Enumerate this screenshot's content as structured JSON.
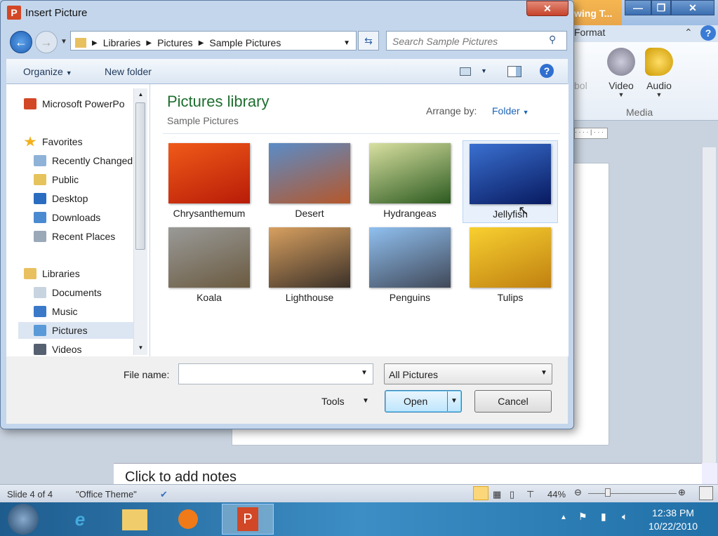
{
  "background_app": {
    "contextual_tab": "wing T...",
    "tab_format": "Format",
    "ribbon": {
      "symbol_partial": "bol",
      "video": "Video",
      "audio": "Audio",
      "group_media": "Media"
    },
    "notes_placeholder": "Click to add notes",
    "status": {
      "slide": "Slide 4 of 4",
      "theme": "\"Office Theme\"",
      "zoom": "44%"
    },
    "window_controls": {
      "minimize": "—",
      "restore": "❐",
      "close": "✕"
    }
  },
  "dialog": {
    "title": "Insert Picture",
    "close": "✕",
    "breadcrumb": [
      "Libraries",
      "Pictures",
      "Sample Pictures"
    ],
    "search_placeholder": "Search Sample Pictures",
    "toolbar": {
      "organize": "Organize",
      "new_folder": "New folder"
    },
    "nav": {
      "items": [
        {
          "label": "Microsoft PowerPo",
          "color": "#d24726"
        },
        {
          "label": "Favorites",
          "color": "#f2b01e",
          "header": true
        },
        {
          "label": "Recently Changed",
          "color": "#8fb2d8"
        },
        {
          "label": "Public",
          "color": "#e6c35c"
        },
        {
          "label": "Desktop",
          "color": "#2a6dc0"
        },
        {
          "label": "Downloads",
          "color": "#4a8ad0"
        },
        {
          "label": "Recent Places",
          "color": "#9aa8b8"
        },
        {
          "label": "Libraries",
          "color": "#e8c060",
          "header": true
        },
        {
          "label": "Documents",
          "color": "#c8d4e0"
        },
        {
          "label": "Music",
          "color": "#3a78c8"
        },
        {
          "label": "Pictures",
          "color": "#5a9ad8",
          "selected": true
        },
        {
          "label": "Videos",
          "color": "#556070"
        }
      ]
    },
    "library": {
      "title": "Pictures library",
      "subtitle": "Sample Pictures",
      "arrange_label": "Arrange by:",
      "arrange_value": "Folder"
    },
    "files": [
      {
        "name": "Chrysanthemum",
        "colors": [
          "#f05a18",
          "#b81c08"
        ]
      },
      {
        "name": "Desert",
        "colors": [
          "#5a8cc8",
          "#b6572a"
        ]
      },
      {
        "name": "Hydrangeas",
        "colors": [
          "#d8e0a0",
          "#2c5a20"
        ]
      },
      {
        "name": "Jellyfish",
        "colors": [
          "#3a70d0",
          "#081a60"
        ],
        "selected": true
      },
      {
        "name": "Koala",
        "colors": [
          "#9a9a98",
          "#6a5a40"
        ]
      },
      {
        "name": "Lighthouse",
        "colors": [
          "#d8a060",
          "#3a3028"
        ]
      },
      {
        "name": "Penguins",
        "colors": [
          "#90c0f0",
          "#404858"
        ]
      },
      {
        "name": "Tulips",
        "colors": [
          "#f8d030",
          "#c08010"
        ]
      }
    ],
    "file_name_label": "File name:",
    "file_name_value": "",
    "filter": "All Pictures",
    "tools": "Tools",
    "open": "Open",
    "cancel": "Cancel"
  },
  "taskbar": {
    "time": "12:38 PM",
    "date": "10/22/2010"
  }
}
